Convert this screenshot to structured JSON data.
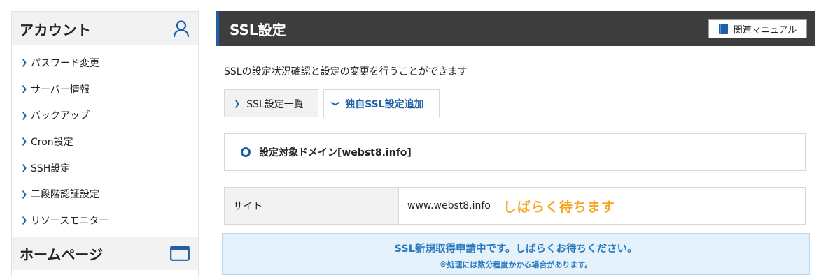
{
  "sidebar": {
    "account_title": "アカウント",
    "items": [
      {
        "label": "パスワード変更"
      },
      {
        "label": "サーバー情報"
      },
      {
        "label": "バックアップ"
      },
      {
        "label": "Cron設定"
      },
      {
        "label": "SSH設定"
      },
      {
        "label": "二段階認証設定"
      },
      {
        "label": "リソースモニター"
      }
    ],
    "homepage_title": "ホームページ",
    "icons": {
      "account": "user-icon",
      "homepage": "browser-window-icon",
      "chevron": "chevron-right-icon"
    }
  },
  "header": {
    "title": "SSL設定",
    "manual_button": "関連マニュアル",
    "manual_icon": "book-icon"
  },
  "description": "SSLの設定状況確認と設定の変更を行うことができます",
  "tabs": [
    {
      "label": "SSL設定一覧",
      "active": false
    },
    {
      "label": "独自SSL設定追加",
      "active": true
    }
  ],
  "domain_target": "設定対象ドメイン[webst8.info]",
  "site": {
    "label": "サイト",
    "value": "www.webst8.info",
    "annotation": "しばらく待ちます"
  },
  "notice": {
    "message": "SSL新規取得申請中です。しばらくお待ちください。",
    "sub_message": "※処理には数分程度かかる場合があります。"
  },
  "colors": {
    "accent": "#1f5fa8",
    "header_bg": "#3d3d3d",
    "notice_bg": "#e6f2fb",
    "notice_text": "#2a7ac0",
    "annotation": "#f5a623"
  }
}
